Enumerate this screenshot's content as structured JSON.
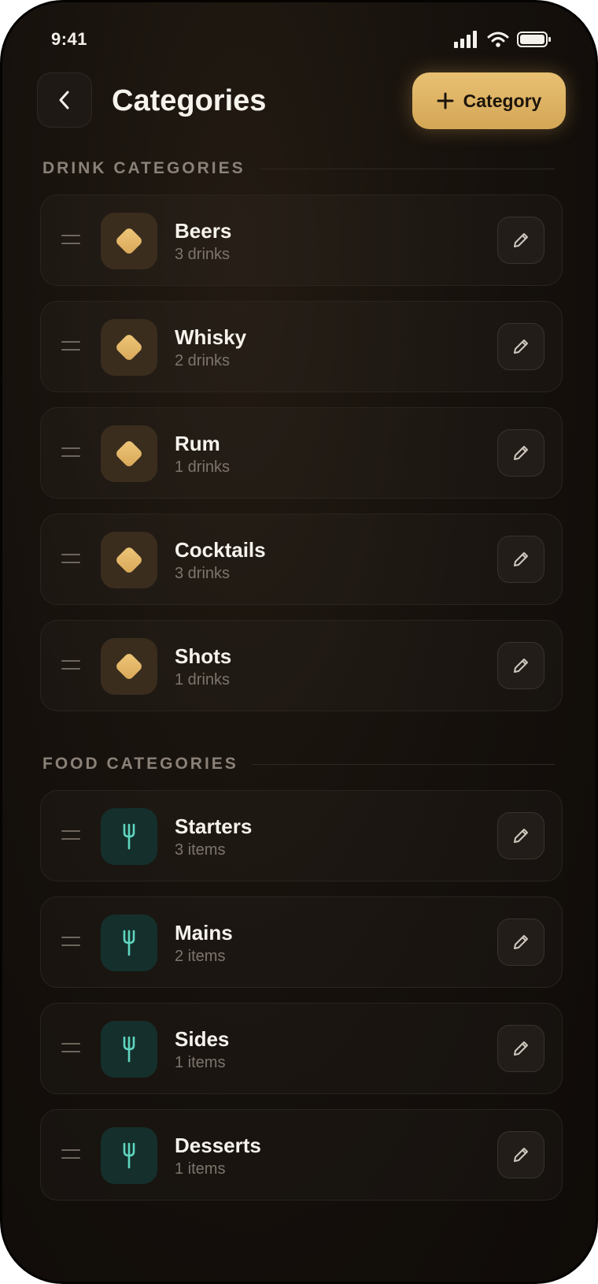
{
  "status_bar": {
    "time": "9:41"
  },
  "header": {
    "title": "Categories",
    "add_label": "Category"
  },
  "drink_section": {
    "label": "DRINK CATEGORIES",
    "items": [
      {
        "name": "Beers",
        "count": "3 drinks"
      },
      {
        "name": "Whisky",
        "count": "2 drinks"
      },
      {
        "name": "Rum",
        "count": "1 drinks"
      },
      {
        "name": "Cocktails",
        "count": "3 drinks"
      },
      {
        "name": "Shots",
        "count": "1 drinks"
      }
    ]
  },
  "food_section": {
    "label": "FOOD CATEGORIES",
    "items": [
      {
        "name": "Starters",
        "count": "3 items"
      },
      {
        "name": "Mains",
        "count": "2 items"
      },
      {
        "name": "Sides",
        "count": "1 items"
      },
      {
        "name": "Desserts",
        "count": "1 items"
      }
    ]
  },
  "icons": {
    "back": "chevron-left-icon",
    "add": "plus-icon",
    "drag": "drag-handle-icon",
    "drink": "diamond-icon",
    "food": "fork-icon",
    "edit": "pencil-icon"
  },
  "colors": {
    "background": "#15100c",
    "accent_gold": "#dcb062",
    "food_teal": "#5fd6c0",
    "text_primary": "#f6f2ec",
    "text_secondary": "#7d756c"
  }
}
